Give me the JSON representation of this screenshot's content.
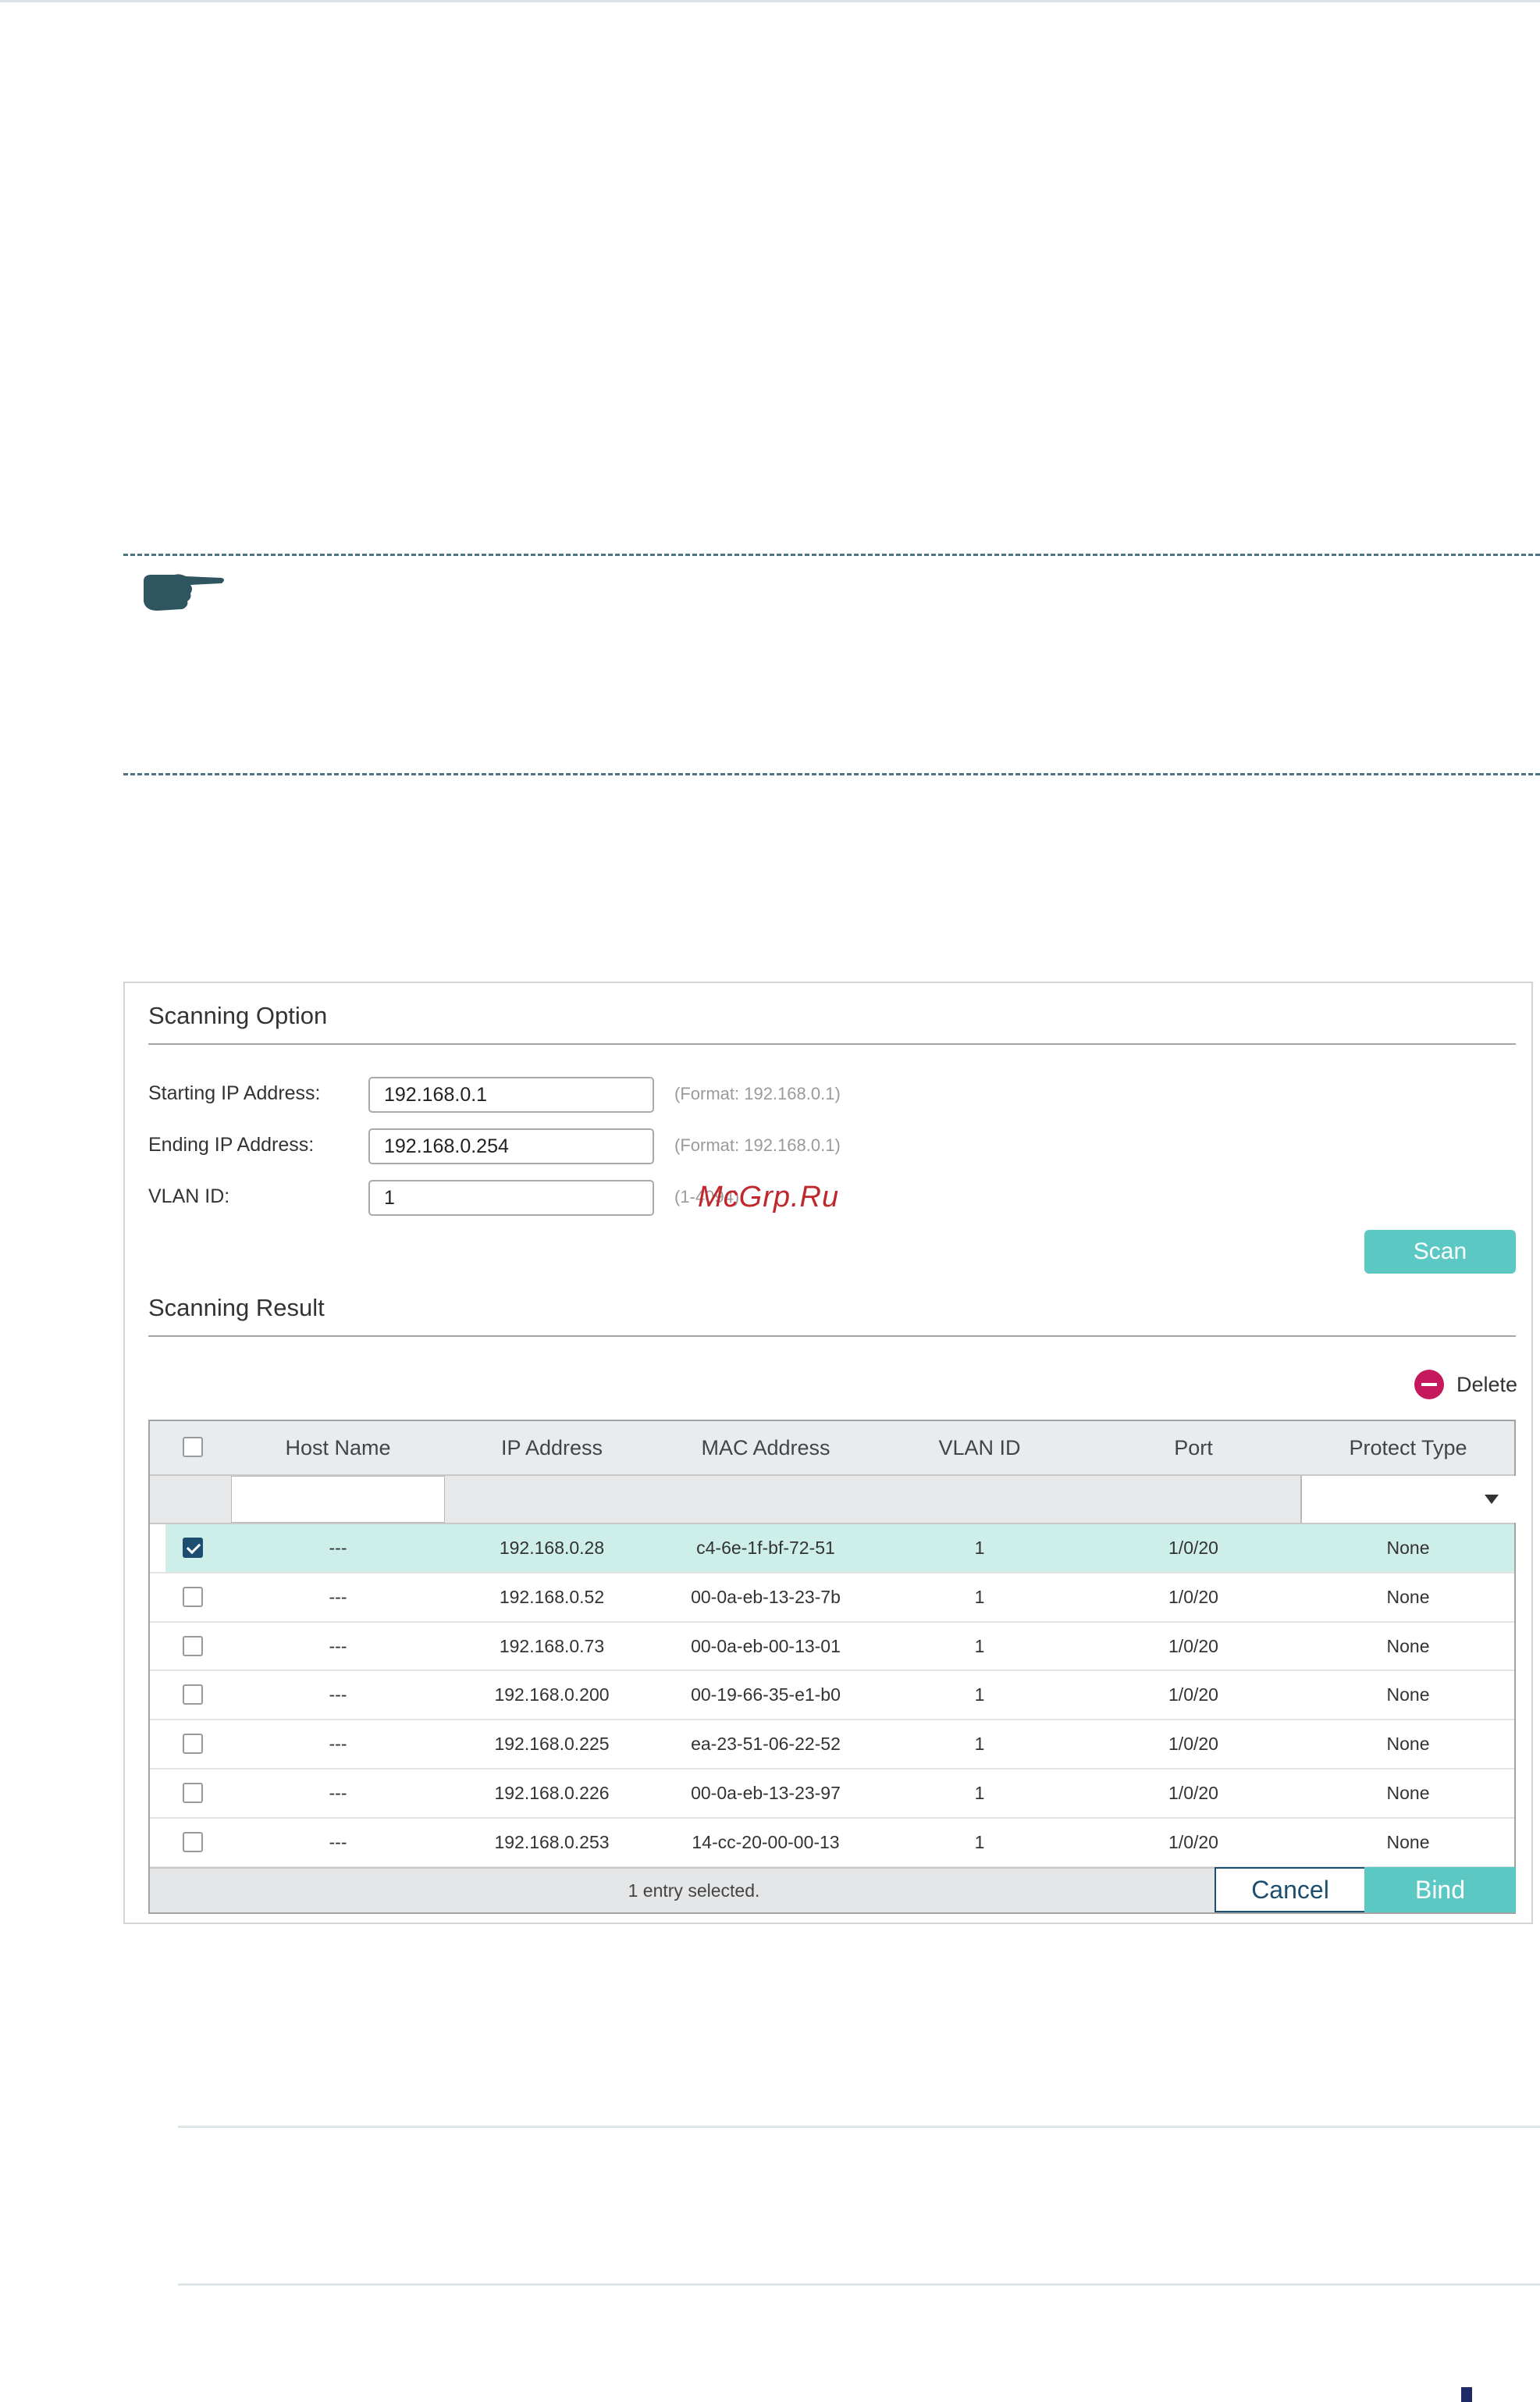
{
  "scanning_option": {
    "title": "Scanning Option",
    "starting_ip_label": "Starting IP Address:",
    "starting_ip_value": "192.168.0.1",
    "starting_ip_hint": "(Format: 192.168.0.1)",
    "ending_ip_label": "Ending IP Address:",
    "ending_ip_value": "192.168.0.254",
    "ending_ip_hint": "(Format: 192.168.0.1)",
    "vlan_label": "VLAN ID:",
    "vlan_value": "1",
    "vlan_hint": "(1-4094)",
    "scan_label": "Scan"
  },
  "watermark": "McGrp.Ru",
  "scanning_result": {
    "title": "Scanning Result",
    "delete_label": "Delete",
    "columns": [
      "Host Name",
      "IP Address",
      "MAC Address",
      "VLAN ID",
      "Port",
      "Protect Type"
    ],
    "rows": [
      {
        "checked": true,
        "host": "---",
        "ip": "192.168.0.28",
        "mac": "c4-6e-1f-bf-72-51",
        "vlan": "1",
        "port": "1/0/20",
        "protect": "None"
      },
      {
        "checked": false,
        "host": "---",
        "ip": "192.168.0.52",
        "mac": "00-0a-eb-13-23-7b",
        "vlan": "1",
        "port": "1/0/20",
        "protect": "None"
      },
      {
        "checked": false,
        "host": "---",
        "ip": "192.168.0.73",
        "mac": "00-0a-eb-00-13-01",
        "vlan": "1",
        "port": "1/0/20",
        "protect": "None"
      },
      {
        "checked": false,
        "host": "---",
        "ip": "192.168.0.200",
        "mac": "00-19-66-35-e1-b0",
        "vlan": "1",
        "port": "1/0/20",
        "protect": "None"
      },
      {
        "checked": false,
        "host": "---",
        "ip": "192.168.0.225",
        "mac": "ea-23-51-06-22-52",
        "vlan": "1",
        "port": "1/0/20",
        "protect": "None"
      },
      {
        "checked": false,
        "host": "---",
        "ip": "192.168.0.226",
        "mac": "00-0a-eb-13-23-97",
        "vlan": "1",
        "port": "1/0/20",
        "protect": "None"
      },
      {
        "checked": false,
        "host": "---",
        "ip": "192.168.0.253",
        "mac": "14-cc-20-00-00-13",
        "vlan": "1",
        "port": "1/0/20",
        "protect": "None"
      }
    ],
    "status_text": "1 entry selected.",
    "cancel_label": "Cancel",
    "bind_label": "Bind"
  }
}
